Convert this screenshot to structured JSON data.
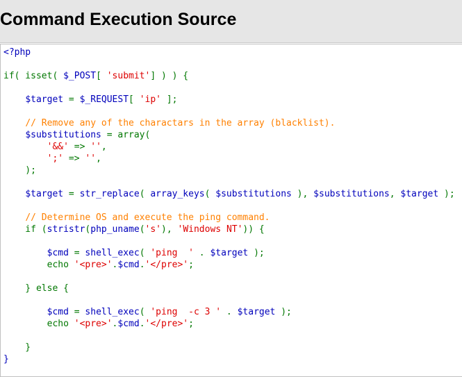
{
  "header": {
    "title": "Command Execution Source"
  },
  "source": {
    "lines": [
      [
        {
          "t": "<?php",
          "c": "var"
        }
      ],
      [],
      [
        {
          "t": "if( isset( ",
          "c": "kw"
        },
        {
          "t": "$_POST",
          "c": "var"
        },
        {
          "t": "[ ",
          "c": "kw"
        },
        {
          "t": "'submit'",
          "c": "str"
        },
        {
          "t": "] ) ) {",
          "c": "kw"
        }
      ],
      [],
      [
        {
          "t": "    ",
          "c": "kw"
        },
        {
          "t": "$target",
          "c": "var"
        },
        {
          "t": " = ",
          "c": "kw"
        },
        {
          "t": "$_REQUEST",
          "c": "var"
        },
        {
          "t": "[ ",
          "c": "kw"
        },
        {
          "t": "'ip'",
          "c": "str"
        },
        {
          "t": " ];",
          "c": "kw"
        }
      ],
      [],
      [
        {
          "t": "    ",
          "c": "kw"
        },
        {
          "t": "// Remove any of the charactars in the array (blacklist).",
          "c": "cm"
        }
      ],
      [
        {
          "t": "    ",
          "c": "kw"
        },
        {
          "t": "$substitutions",
          "c": "var"
        },
        {
          "t": " = ",
          "c": "kw"
        },
        {
          "t": "array(",
          "c": "kw"
        }
      ],
      [
        {
          "t": "        ",
          "c": "kw"
        },
        {
          "t": "'&&'",
          "c": "str"
        },
        {
          "t": " => ",
          "c": "kw"
        },
        {
          "t": "''",
          "c": "str"
        },
        {
          "t": ",",
          "c": "kw"
        }
      ],
      [
        {
          "t": "        ",
          "c": "kw"
        },
        {
          "t": "';'",
          "c": "str"
        },
        {
          "t": " => ",
          "c": "kw"
        },
        {
          "t": "''",
          "c": "str"
        },
        {
          "t": ",",
          "c": "kw"
        }
      ],
      [
        {
          "t": "    );",
          "c": "kw"
        }
      ],
      [],
      [
        {
          "t": "    ",
          "c": "kw"
        },
        {
          "t": "$target",
          "c": "var"
        },
        {
          "t": " = ",
          "c": "kw"
        },
        {
          "t": "str_replace",
          "c": "var"
        },
        {
          "t": "( ",
          "c": "kw"
        },
        {
          "t": "array_keys",
          "c": "var"
        },
        {
          "t": "( ",
          "c": "kw"
        },
        {
          "t": "$substitutions",
          "c": "var"
        },
        {
          "t": " ), ",
          "c": "kw"
        },
        {
          "t": "$substitutions",
          "c": "var"
        },
        {
          "t": ", ",
          "c": "kw"
        },
        {
          "t": "$target",
          "c": "var"
        },
        {
          "t": " );",
          "c": "kw"
        }
      ],
      [],
      [
        {
          "t": "    ",
          "c": "kw"
        },
        {
          "t": "// Determine OS and execute the ping command.",
          "c": "cm"
        }
      ],
      [
        {
          "t": "    if (",
          "c": "kw"
        },
        {
          "t": "stristr",
          "c": "var"
        },
        {
          "t": "(",
          "c": "kw"
        },
        {
          "t": "php_uname",
          "c": "var"
        },
        {
          "t": "(",
          "c": "kw"
        },
        {
          "t": "'s'",
          "c": "str"
        },
        {
          "t": "), ",
          "c": "kw"
        },
        {
          "t": "'Windows NT'",
          "c": "str"
        },
        {
          "t": ")) {",
          "c": "kw"
        }
      ],
      [],
      [
        {
          "t": "        ",
          "c": "kw"
        },
        {
          "t": "$cmd",
          "c": "var"
        },
        {
          "t": " = ",
          "c": "kw"
        },
        {
          "t": "shell_exec",
          "c": "var"
        },
        {
          "t": "( ",
          "c": "kw"
        },
        {
          "t": "'ping  '",
          "c": "str"
        },
        {
          "t": " . ",
          "c": "kw"
        },
        {
          "t": "$target",
          "c": "var"
        },
        {
          "t": " );",
          "c": "kw"
        }
      ],
      [
        {
          "t": "        echo ",
          "c": "kw"
        },
        {
          "t": "'<pre>'",
          "c": "str"
        },
        {
          "t": ".",
          "c": "kw"
        },
        {
          "t": "$cmd",
          "c": "var"
        },
        {
          "t": ".",
          "c": "kw"
        },
        {
          "t": "'</pre>'",
          "c": "str"
        },
        {
          "t": ";",
          "c": "kw"
        }
      ],
      [],
      [
        {
          "t": "    } else {",
          "c": "kw"
        }
      ],
      [],
      [
        {
          "t": "        ",
          "c": "kw"
        },
        {
          "t": "$cmd",
          "c": "var"
        },
        {
          "t": " = ",
          "c": "kw"
        },
        {
          "t": "shell_exec",
          "c": "var"
        },
        {
          "t": "( ",
          "c": "kw"
        },
        {
          "t": "'ping  -c 3 '",
          "c": "str"
        },
        {
          "t": " . ",
          "c": "kw"
        },
        {
          "t": "$target",
          "c": "var"
        },
        {
          "t": " );",
          "c": "kw"
        }
      ],
      [
        {
          "t": "        echo ",
          "c": "kw"
        },
        {
          "t": "'<pre>'",
          "c": "str"
        },
        {
          "t": ".",
          "c": "kw"
        },
        {
          "t": "$cmd",
          "c": "var"
        },
        {
          "t": ".",
          "c": "kw"
        },
        {
          "t": "'</pre>'",
          "c": "str"
        },
        {
          "t": ";",
          "c": "kw"
        }
      ],
      [],
      [
        {
          "t": "    }",
          "c": "kw"
        }
      ],
      [
        {
          "t": "}",
          "c": "var"
        }
      ]
    ]
  },
  "colors": {
    "keyword": "#007700",
    "variable": "#0000bb",
    "string": "#dd0000",
    "comment": "#ff8000",
    "header_bg": "#e6e6e6"
  }
}
